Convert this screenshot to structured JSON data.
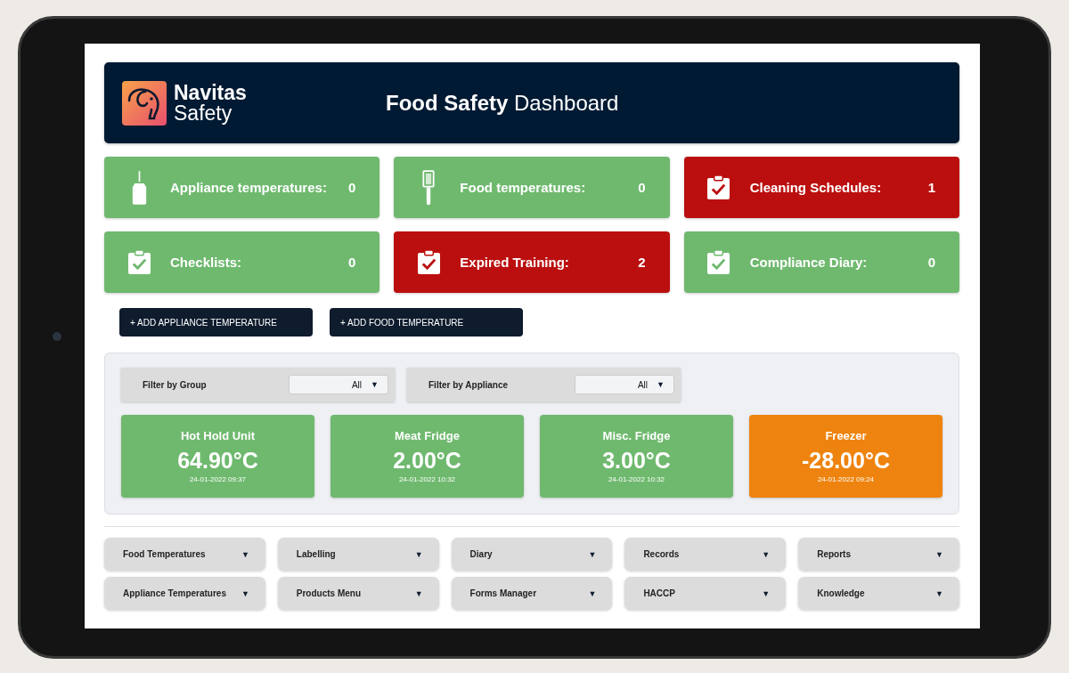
{
  "brand": {
    "name": "Navitas",
    "subname": "Safety"
  },
  "header": {
    "title_bold": "Food Safety",
    "title_rest": "Dashboard"
  },
  "summary_cards": [
    {
      "kind": "probe",
      "label": "Appliance temperatures:",
      "count": "0",
      "color": "#6fb96f"
    },
    {
      "kind": "thermometer",
      "label": "Food temperatures:",
      "count": "0",
      "color": "#6fb96f"
    },
    {
      "kind": "clipboard",
      "label": "Cleaning Schedules:",
      "count": "1",
      "color": "#bb0f0f"
    },
    {
      "kind": "clipboard",
      "label": "Checklists:",
      "count": "0",
      "color": "#6fb96f"
    },
    {
      "kind": "clipboard",
      "label": "Expired Training:",
      "count": "2",
      "color": "#bb0f0f"
    },
    {
      "kind": "clipboard",
      "label": "Compliance Diary:",
      "count": "0",
      "color": "#6fb96f"
    }
  ],
  "actions": [
    "+ ADD APPLIANCE TEMPERATURE",
    "+ ADD FOOD TEMPERATURE"
  ],
  "filters": [
    {
      "label": "Filter by Group",
      "value": "All"
    },
    {
      "label": "Filter by Appliance",
      "value": "All"
    }
  ],
  "appliances": [
    {
      "name": "Hot Hold Unit",
      "temperature": "64.90°C",
      "time": "24-01-2022 09:37",
      "color": "#6fb96f"
    },
    {
      "name": "Meat Fridge",
      "temperature": "2.00°C",
      "time": "24-01-2022 10:32",
      "color": "#6fb96f"
    },
    {
      "name": "Misc. Fridge",
      "temperature": "3.00°C",
      "time": "24-01-2022 10:32",
      "color": "#6fb96f"
    },
    {
      "name": "Freezer",
      "temperature": "-28.00°C",
      "time": "24-01-2022 09:24",
      "color": "#ee840f"
    }
  ],
  "menus": [
    {
      "label": "Food Temperatures",
      "caret": "▼"
    },
    {
      "label": "Labelling",
      "caret": "▼"
    },
    {
      "label": "Diary",
      "caret": "▼"
    },
    {
      "label": "Records",
      "caret": "▼"
    },
    {
      "label": "Reports",
      "caret": "▼"
    },
    {
      "label": "Appliance Temperatures",
      "caret": "▼"
    },
    {
      "label": "Products Menu",
      "caret": "▼"
    },
    {
      "label": "Forms Manager",
      "caret": "▼"
    },
    {
      "label": "HACCP",
      "caret": "▼"
    },
    {
      "label": "Knowledge",
      "caret": "▼"
    }
  ],
  "filter_caret": "▼"
}
